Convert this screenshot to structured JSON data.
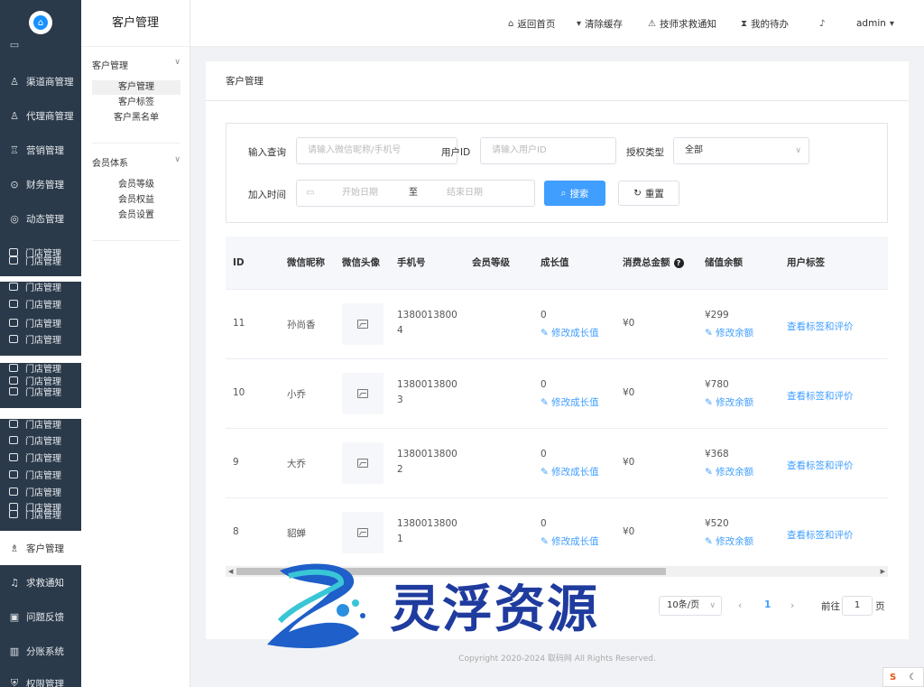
{
  "nav": {
    "items_top": [
      {
        "label": "渠道商管理",
        "icon": "person-icon"
      },
      {
        "label": "代理商管理",
        "icon": "person-icon"
      },
      {
        "label": "营销管理",
        "icon": "marketing-icon"
      },
      {
        "label": "财务管理",
        "icon": "lock-icon"
      },
      {
        "label": "动态管理",
        "icon": "compass-icon"
      }
    ],
    "store_items": [
      "门店管理",
      "门店管理",
      "门店管理",
      "门店管理",
      "门店管理",
      "门店管理",
      "门店管理",
      "门店管理",
      "门店管理",
      "门店管理",
      "门店管理",
      "门店管理",
      "门店管理",
      "门店管理",
      "门店管理",
      "门店管理",
      "门店管理",
      "门店管理"
    ],
    "items_bottom": [
      {
        "label": "客户管理",
        "icon": "users-icon",
        "active": true
      },
      {
        "label": "求救通知",
        "icon": "bell-icon"
      },
      {
        "label": "问题反馈",
        "icon": "feedback-icon"
      },
      {
        "label": "分账系统",
        "icon": "bar-chart-icon"
      },
      {
        "label": "权限管理",
        "icon": "shield-icon"
      }
    ]
  },
  "subnav": {
    "title": "客户管理",
    "groups": [
      {
        "label": "客户管理",
        "items": [
          "客户管理",
          "客户标签",
          "客户黑名单"
        ]
      },
      {
        "label": "会员体系",
        "items": [
          "会员等级",
          "会员权益",
          "会员设置"
        ]
      }
    ]
  },
  "topbar": {
    "home": "返回首页",
    "clear_cache": "清除缓存",
    "tech_notice": "技师求救通知",
    "todo": "我的待办",
    "user": "admin"
  },
  "page": {
    "breadcrumb": "客户管理"
  },
  "filter": {
    "query_label": "输入查询",
    "query_placeholder": "请输入微信昵称/手机号",
    "uid_label": "用户ID",
    "uid_placeholder": "请输入用户ID",
    "auth_label": "授权类型",
    "auth_value": "全部",
    "join_label": "加入时间",
    "start_placeholder": "开始日期",
    "range_sep": "至",
    "end_placeholder": "结束日期",
    "search_btn": "搜索",
    "reset_btn": "重置"
  },
  "table": {
    "headers": [
      "ID",
      "微信昵称",
      "微信头像",
      "手机号",
      "会员等级",
      "成长值",
      "消费总金额",
      "储值余额",
      "用户标签"
    ],
    "edit_growth": "修改成长值",
    "edit_balance": "修改余额",
    "view_tags": "查看标签和评价",
    "rows": [
      {
        "id": "11",
        "nickname": "孙尚香",
        "phone1": "1380013800",
        "phone2": "4",
        "growth": "0",
        "total": "¥0",
        "balance": "¥299"
      },
      {
        "id": "10",
        "nickname": "小乔",
        "phone1": "1380013800",
        "phone2": "3",
        "growth": "0",
        "total": "¥0",
        "balance": "¥780"
      },
      {
        "id": "9",
        "nickname": "大乔",
        "phone1": "1380013800",
        "phone2": "2",
        "growth": "0",
        "total": "¥0",
        "balance": "¥368"
      },
      {
        "id": "8",
        "nickname": "貂蝉",
        "phone1": "1380013800",
        "phone2": "1",
        "growth": "0",
        "total": "¥0",
        "balance": "¥520"
      }
    ]
  },
  "pagination": {
    "page_size": "10条/页",
    "current": "1",
    "goto_label": "前往",
    "goto_value": "1",
    "page_unit": "页"
  },
  "footer": {
    "copyright": "Copyright 2020-2024 取码网 All Rights Reserved."
  },
  "watermark": {
    "text": "灵浮资源"
  },
  "colors": {
    "sidebar": "#2b3a4a",
    "primary": "#409eff"
  }
}
